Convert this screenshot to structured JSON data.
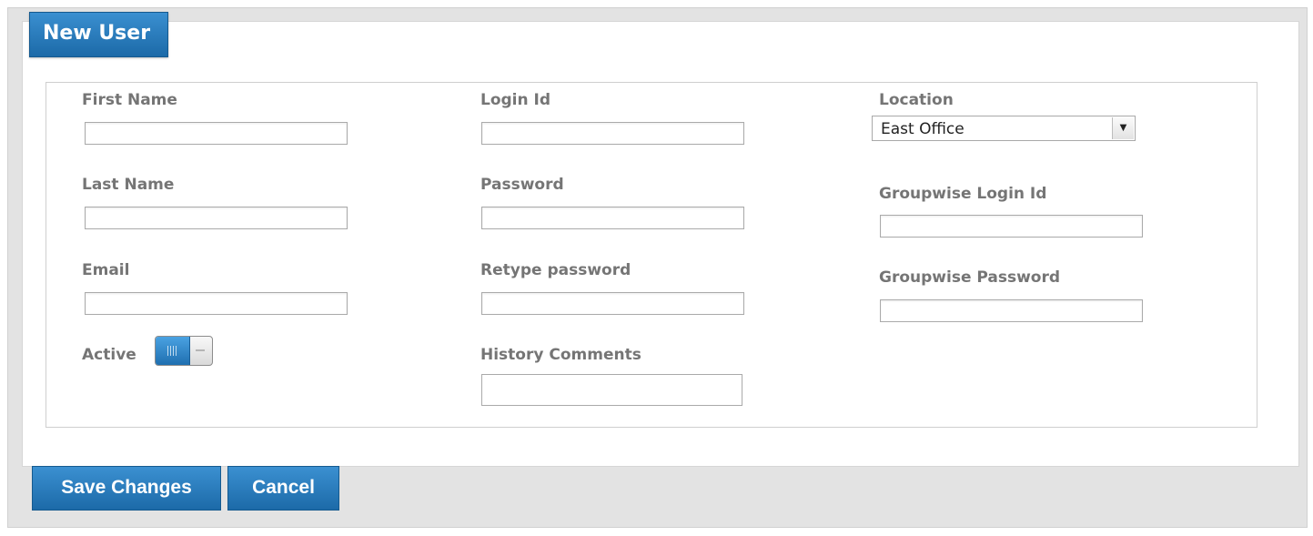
{
  "form": {
    "title": "New User",
    "fields": {
      "first_name": {
        "label": "First Name",
        "value": ""
      },
      "last_name": {
        "label": "Last Name",
        "value": ""
      },
      "email": {
        "label": "Email",
        "value": ""
      },
      "active": {
        "label": "Active",
        "checked": true
      },
      "login_id": {
        "label": "Login Id",
        "value": ""
      },
      "password": {
        "label": "Password",
        "value": ""
      },
      "retype_password": {
        "label": "Retype password",
        "value": ""
      },
      "history_comments": {
        "label": "History Comments",
        "value": ""
      },
      "location": {
        "label": "Location",
        "selected": "East Office"
      },
      "groupwise_login_id": {
        "label": "Groupwise Login Id",
        "value": ""
      },
      "groupwise_password": {
        "label": "Groupwise Password",
        "value": ""
      }
    }
  },
  "actions": {
    "save_label": "Save Changes",
    "cancel_label": "Cancel"
  },
  "colors": {
    "accent": "#1f72b3",
    "label": "#757575",
    "panel_background": "#e3e3e3"
  }
}
